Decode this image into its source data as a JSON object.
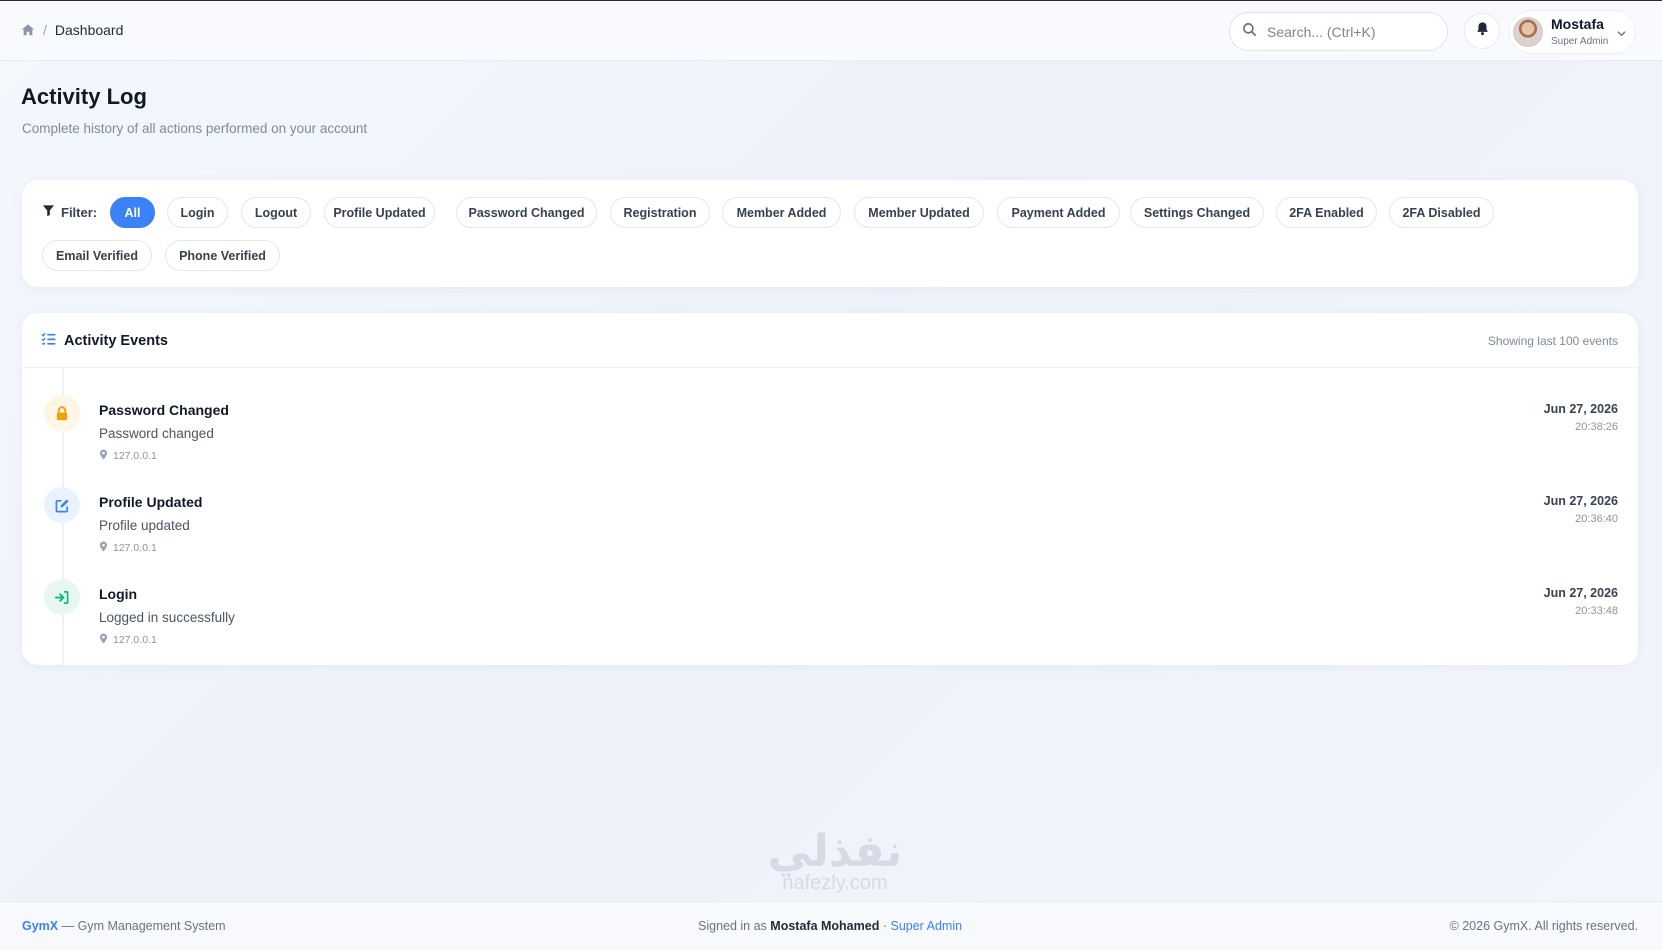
{
  "breadcrumb": {
    "current": "Dashboard"
  },
  "search": {
    "placeholder": "Search... (Ctrl+K)"
  },
  "user": {
    "name": "Mostafa",
    "role": "Super Admin"
  },
  "page": {
    "title": "Activity Log",
    "subtitle": "Complete history of all actions performed on your account"
  },
  "filter": {
    "label": "Filter:",
    "chips": [
      "All",
      "Login",
      "Logout",
      "Profile Updated",
      "Password Changed",
      "Registration",
      "Member Added",
      "Member Updated",
      "Payment Added",
      "Settings Changed",
      "2FA Enabled",
      "2FA Disabled",
      "Email Verified",
      "Phone Verified"
    ],
    "active": "All"
  },
  "events": {
    "title": "Activity Events",
    "count_text": "Showing last 100 events",
    "items": [
      {
        "name": "Password Changed",
        "desc": "Password changed",
        "ip": "127.0.0.1",
        "date": "Jun 27, 2026",
        "time": "20:38:26",
        "icon": "lock-icon",
        "color": "#f59e0b"
      },
      {
        "name": "Profile Updated",
        "desc": "Profile updated",
        "ip": "127.0.0.1",
        "date": "Jun 27, 2026",
        "time": "20:36:40",
        "icon": "edit-icon",
        "color": "#3b82f6"
      },
      {
        "name": "Login",
        "desc": "Logged in successfully",
        "ip": "127.0.0.1",
        "date": "Jun 27, 2026",
        "time": "20:33:48",
        "icon": "login-icon",
        "color": "#10b981"
      }
    ]
  },
  "watermark": {
    "arabic": "نفذلي",
    "latin": "nafezly.com"
  },
  "footer": {
    "brand": "GymX",
    "tagline": "— Gym Management System",
    "signed_prefix": "Signed in as",
    "signed_name": "Mostafa Mohamed",
    "signed_sep": "·",
    "signed_role": "Super Admin",
    "copyright": "© 2026 GymX. All rights reserved."
  },
  "colors": {
    "accent": "#3b82f6",
    "warning": "#f59e0b",
    "success": "#10b981"
  }
}
